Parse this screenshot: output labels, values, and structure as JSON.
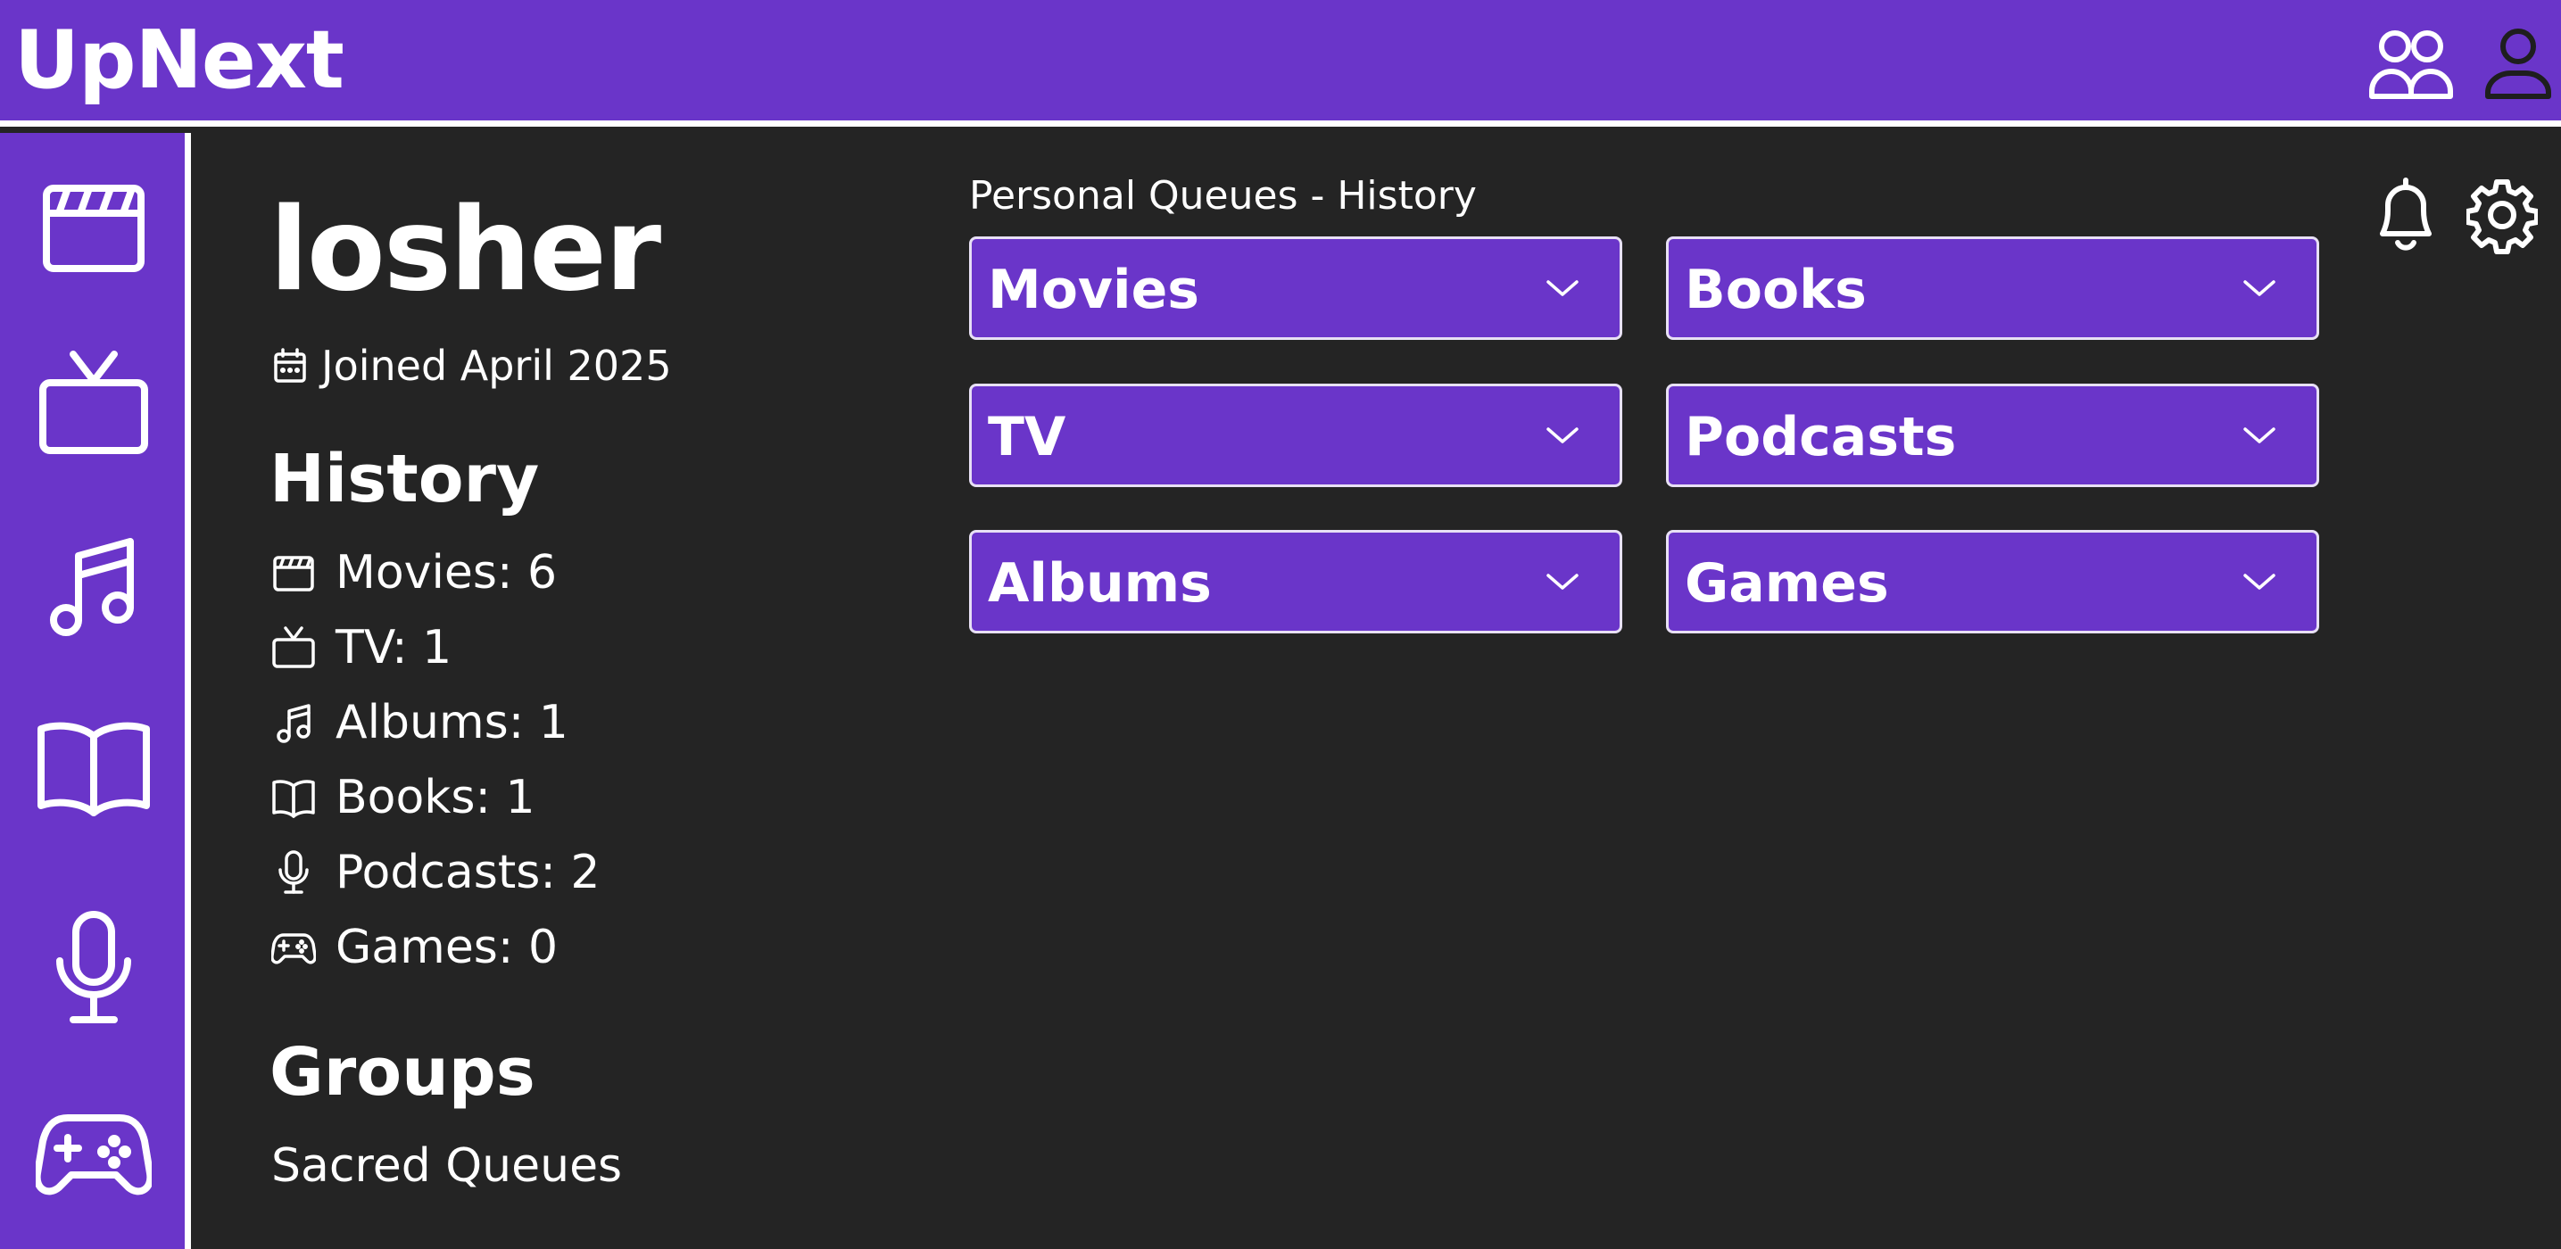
{
  "app": {
    "title": "UpNext"
  },
  "header": {
    "icons": [
      "groups-icon",
      "user-profile-icon"
    ]
  },
  "sidebar": {
    "items": [
      {
        "icon": "movie-clapperboard-icon",
        "category": "Movies"
      },
      {
        "icon": "tv-icon",
        "category": "TV"
      },
      {
        "icon": "music-note-icon",
        "category": "Albums"
      },
      {
        "icon": "book-icon",
        "category": "Books"
      },
      {
        "icon": "microphone-icon",
        "category": "Podcasts"
      },
      {
        "icon": "gamepad-icon",
        "category": "Games"
      }
    ]
  },
  "profile": {
    "username": "losher",
    "joined": "Joined April 2025",
    "history_title": "History",
    "history": [
      {
        "label": "Movies: 6",
        "icon": "clapperboard-icon"
      },
      {
        "label": "TV: 1",
        "icon": "tv-icon"
      },
      {
        "label": "Albums: 1",
        "icon": "music-note-icon"
      },
      {
        "label": "Books: 1",
        "icon": "book-icon"
      },
      {
        "label": "Podcasts: 2",
        "icon": "microphone-icon"
      },
      {
        "label": "Games: 0",
        "icon": "gamepad-icon"
      }
    ],
    "groups_title": "Groups",
    "groups": [
      "Sacred Queues"
    ]
  },
  "queues": {
    "heading": "Personal Queues - History",
    "items": [
      {
        "label": "Movies"
      },
      {
        "label": "Books"
      },
      {
        "label": "TV"
      },
      {
        "label": "Podcasts"
      },
      {
        "label": "Albums"
      },
      {
        "label": "Games"
      }
    ]
  },
  "toolbar": {
    "icons": [
      "bell-icon",
      "settings-gear-icon"
    ]
  },
  "colors": {
    "brand": "#6a35c9",
    "background": "#242424",
    "text": "#ffffff"
  }
}
